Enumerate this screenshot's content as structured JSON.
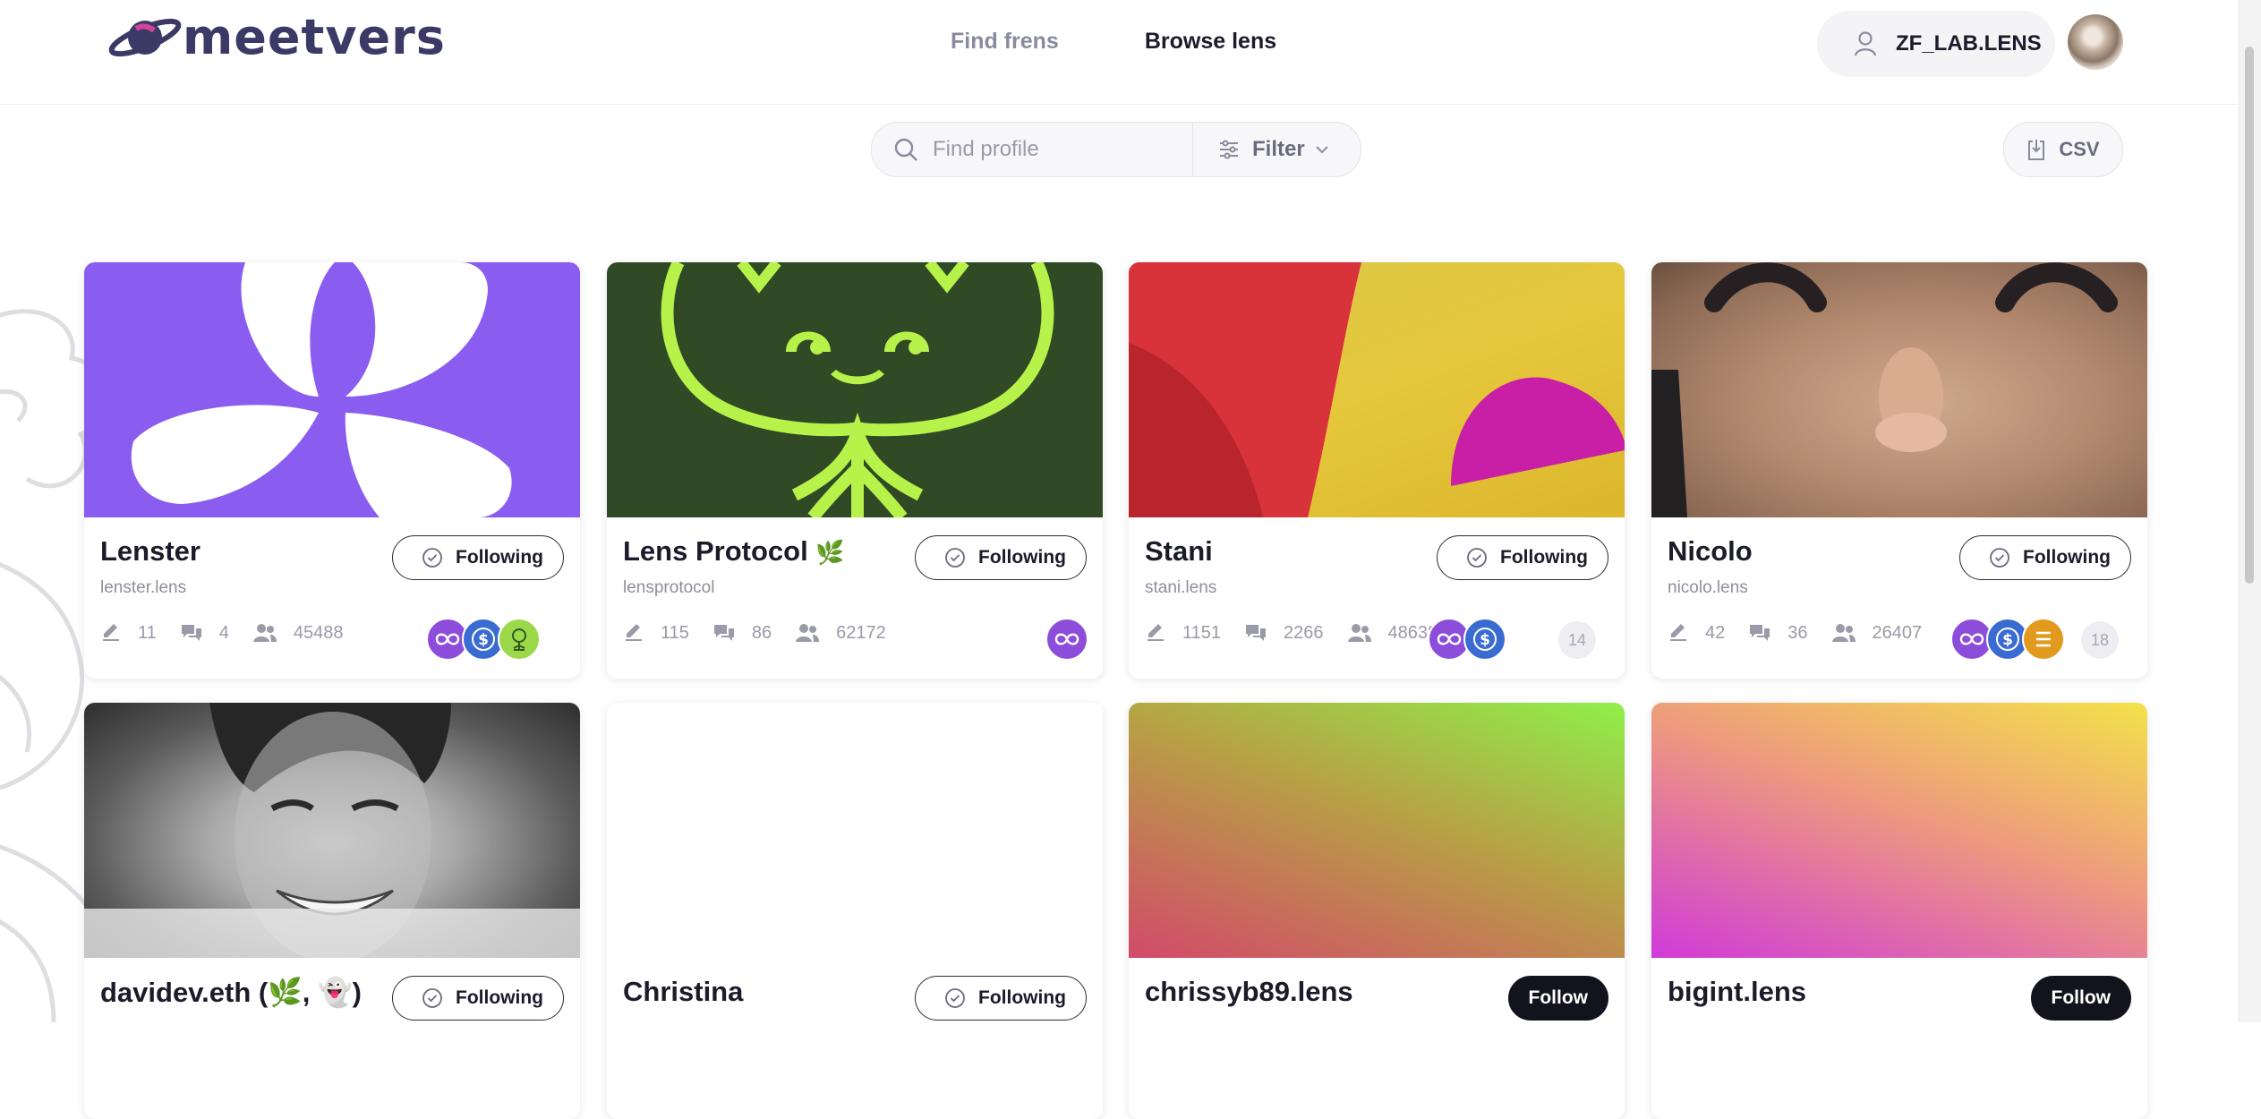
{
  "brand": {
    "name": "meetvers"
  },
  "nav": {
    "items": [
      "Find frens",
      "Browse lens"
    ],
    "active_index": 1
  },
  "account": {
    "handle": "ZF_LAB.LENS"
  },
  "toolbar": {
    "search_placeholder": "Find profile",
    "filter_label": "Filter",
    "csv_label": "CSV"
  },
  "profiles": [
    {
      "name": "Lenster",
      "handle": "lenster.lens",
      "button": "Following",
      "posts": "11",
      "comments": "4",
      "followers": "45488",
      "badges": [
        "lens-protocol-icon",
        "usdc-icon",
        "plant-icon"
      ]
    },
    {
      "name": "Lens Protocol",
      "name_suffix": "🌿",
      "handle": "lensprotocol",
      "button": "Following",
      "posts": "115",
      "comments": "86",
      "followers": "62172",
      "badges": [
        "lens-protocol-icon"
      ]
    },
    {
      "name": "Stani",
      "handle": "stani.lens",
      "button": "Following",
      "posts": "1151",
      "comments": "2266",
      "followers": "48638",
      "badges": [
        "lens-protocol-icon",
        "usdc-icon"
      ],
      "more_count": "14"
    },
    {
      "name": "Nicolo",
      "handle": "nicolo.lens",
      "button": "Following",
      "posts": "42",
      "comments": "36",
      "followers": "26407",
      "badges": [
        "lens-protocol-icon",
        "usdc-icon",
        "eth-icon"
      ],
      "more_count": "18"
    },
    {
      "name": "davidev.eth (🌿, 👻)",
      "button": "Following"
    },
    {
      "name": "Christina",
      "button": "Following"
    },
    {
      "name": "chrissyb89.lens",
      "button": "Follow"
    },
    {
      "name": "bigint.lens",
      "button": "Follow"
    }
  ],
  "colors": {
    "brand": "#3b3a66",
    "lens_purple": "#8c4ddb",
    "usdc_blue": "#3a6bd1",
    "eth_gold": "#e29a1e",
    "follow_button": "#13131d"
  }
}
